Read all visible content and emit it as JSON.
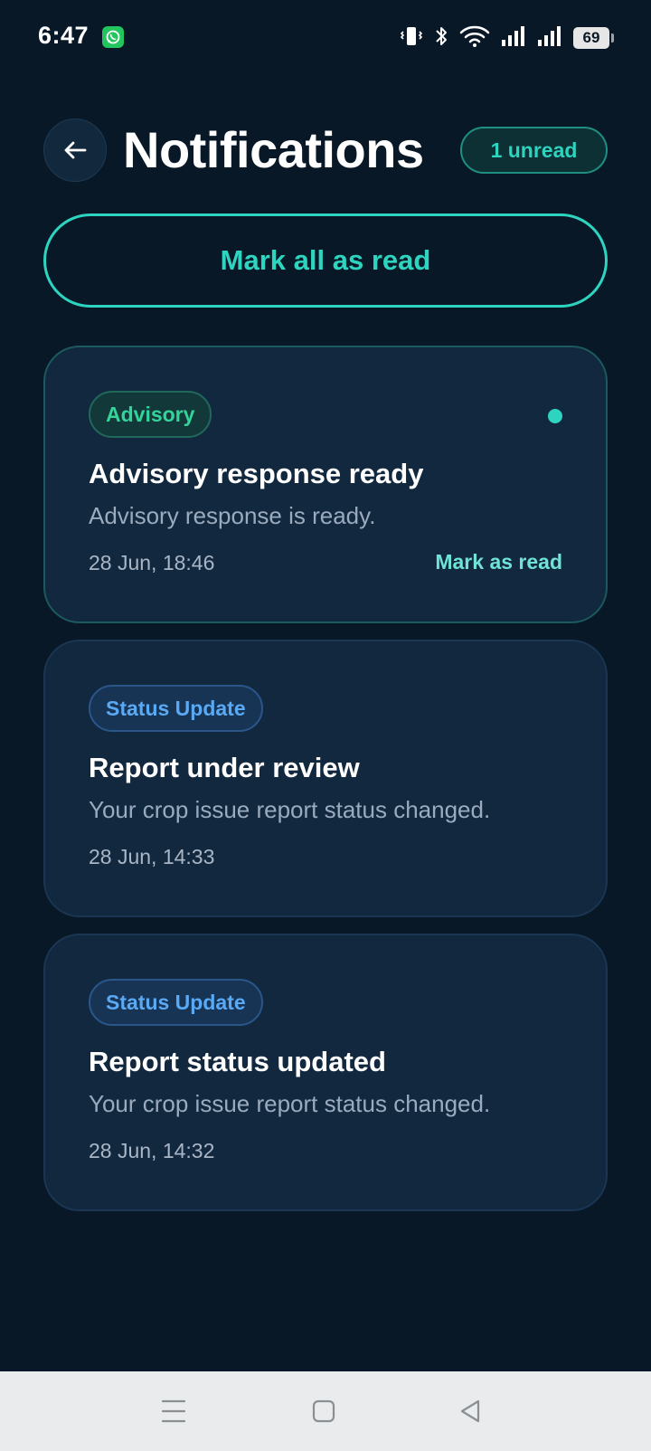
{
  "status_bar": {
    "time": "6:47",
    "battery": "69",
    "icons": [
      "whatsapp-icon",
      "vibrate-icon",
      "bluetooth-icon",
      "wifi-icon",
      "signal-icon",
      "signal-icon",
      "battery-icon"
    ]
  },
  "header": {
    "back_icon": "arrow-left-icon",
    "title": "Notifications",
    "unread_badge": "1 unread"
  },
  "actions": {
    "mark_all_label": "Mark all as read"
  },
  "notifications": [
    {
      "category": "Advisory",
      "title": "Advisory response ready",
      "message": "Advisory response is ready.",
      "time": "28 Jun, 18:46",
      "unread": true,
      "mark_read_label": "Mark as read"
    },
    {
      "category": "Status Update",
      "title": "Report under review",
      "message": "Your crop issue report status changed.",
      "time": "28 Jun, 14:33",
      "unread": false
    },
    {
      "category": "Status Update",
      "title": "Report status updated",
      "message": "Your crop issue report status changed.",
      "time": "28 Jun, 14:32",
      "unread": false
    }
  ],
  "colors": {
    "background": "#081826",
    "accent": "#2dd4bf",
    "card": "#12283f",
    "advisory": "#34d399",
    "status_update": "#5aa9f5"
  },
  "nav_bar": {
    "icons": [
      "menu-icon",
      "home-icon",
      "back-icon"
    ]
  }
}
